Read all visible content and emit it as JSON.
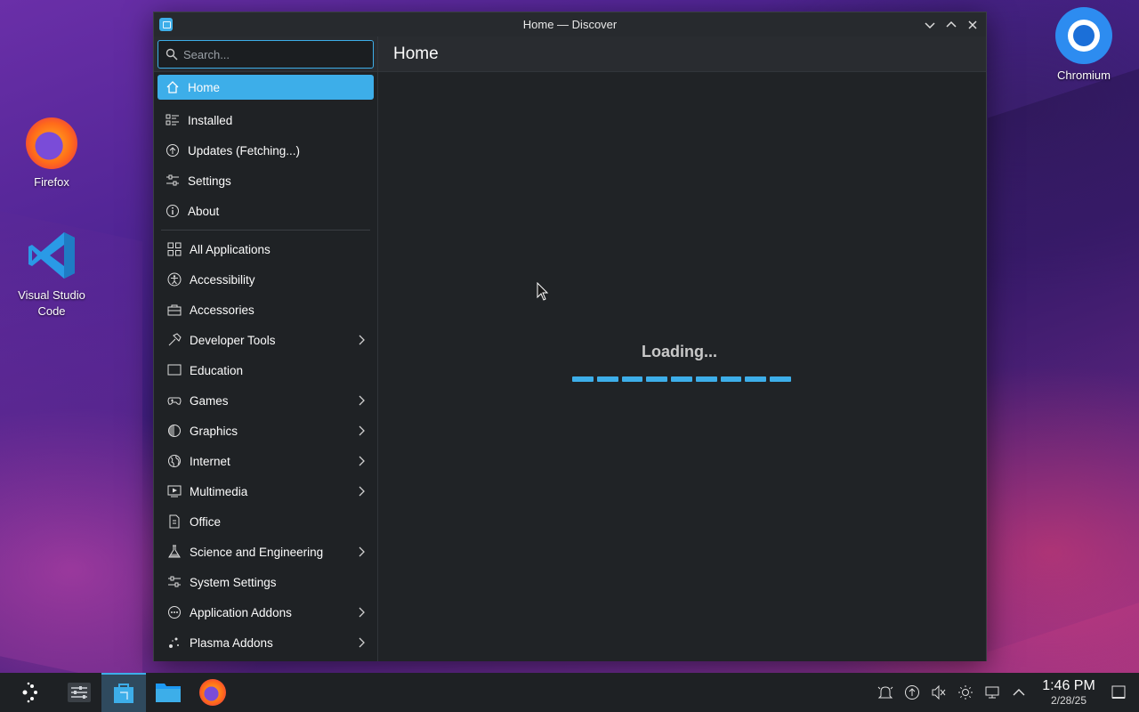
{
  "desktop": {
    "icons": [
      {
        "label": "Firefox"
      },
      {
        "label": "Visual Studio Code"
      },
      {
        "label": "Chromium"
      }
    ]
  },
  "window": {
    "title": "Home — Discover",
    "search_placeholder": "Search...",
    "page_title": "Home",
    "nav": [
      {
        "label": "Home",
        "icon": "home-icon"
      },
      {
        "label": "Installed",
        "icon": "installed-icon"
      },
      {
        "label": "Updates (Fetching...)",
        "icon": "updates-icon"
      },
      {
        "label": "Settings",
        "icon": "settings-icon"
      },
      {
        "label": "About",
        "icon": "info-icon"
      }
    ],
    "categories": [
      {
        "label": "All Applications",
        "icon": "grid-icon",
        "expandable": false
      },
      {
        "label": "Accessibility",
        "icon": "accessibility-icon",
        "expandable": false
      },
      {
        "label": "Accessories",
        "icon": "toolbox-icon",
        "expandable": false
      },
      {
        "label": "Developer Tools",
        "icon": "hammer-icon",
        "expandable": true
      },
      {
        "label": "Education",
        "icon": "board-icon",
        "expandable": false
      },
      {
        "label": "Games",
        "icon": "gamepad-icon",
        "expandable": true
      },
      {
        "label": "Graphics",
        "icon": "graphics-icon",
        "expandable": true
      },
      {
        "label": "Internet",
        "icon": "globe-icon",
        "expandable": true
      },
      {
        "label": "Multimedia",
        "icon": "multimedia-icon",
        "expandable": true
      },
      {
        "label": "Office",
        "icon": "document-icon",
        "expandable": false
      },
      {
        "label": "Science and Engineering",
        "icon": "flask-icon",
        "expandable": true
      },
      {
        "label": "System Settings",
        "icon": "sliders-icon",
        "expandable": false
      },
      {
        "label": "Application Addons",
        "icon": "addons-icon",
        "expandable": true
      },
      {
        "label": "Plasma Addons",
        "icon": "plasma-icon",
        "expandable": true
      }
    ],
    "loading_text": "Loading..."
  },
  "taskbar": {
    "time": "1:46 PM",
    "date": "2/28/25"
  },
  "colors": {
    "accent": "#3daee9",
    "window_bg": "#202326",
    "taskbar_bg": "#1e2124"
  }
}
